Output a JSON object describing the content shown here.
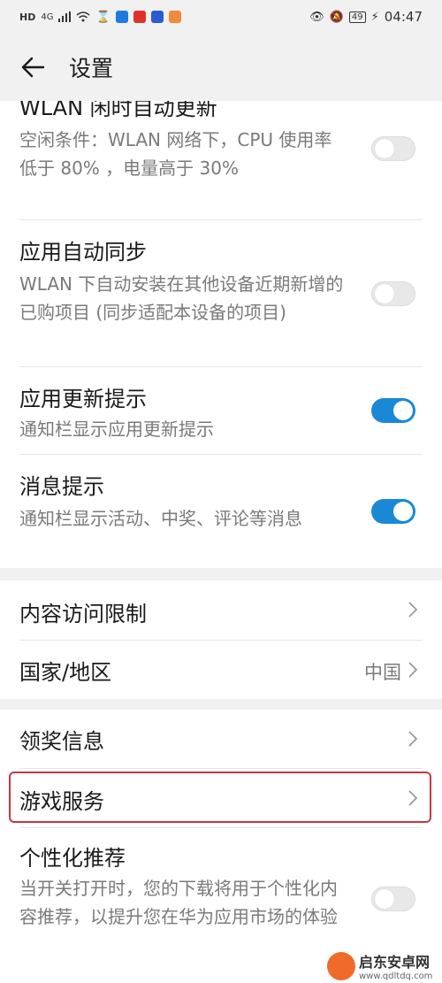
{
  "status_bar": {
    "left_label": "HD",
    "network": "4G",
    "right_battery": "49",
    "time": "04:47"
  },
  "header": {
    "title": "设置"
  },
  "settings": {
    "wlan_idle": {
      "title": "WLAN 闲时自动更新",
      "desc": "空闲条件：WLAN 网络下，CPU 使用率低于 80% ，电量高于 30%",
      "on": false
    },
    "app_sync": {
      "title": "应用自动同步",
      "desc": "WLAN 下自动安装在其他设备近期新增的已购项目 (同步适配本设备的项目)",
      "on": false
    },
    "update_notice": {
      "title": "应用更新提示",
      "desc": "通知栏显示应用更新提示",
      "on": true
    },
    "msg_notice": {
      "title": "消息提示",
      "desc": "通知栏显示活动、中奖、评论等消息",
      "on": true
    },
    "content_limit": {
      "title": "内容访问限制"
    },
    "region": {
      "title": "国家/地区",
      "value": "中国"
    },
    "prize_info": {
      "title": "领奖信息"
    },
    "game_service": {
      "title": "游戏服务"
    },
    "personalized": {
      "title": "个性化推荐",
      "desc": "当开关打开时，您的下载将用于个性化内容推荐，以提升您在华为应用市场的体验",
      "on": false
    }
  },
  "watermark": {
    "name": "启东安卓网",
    "url": "www.qdltdq.com"
  },
  "colors": {
    "accent": "#1b88d6",
    "highlight": "#c0394b"
  }
}
